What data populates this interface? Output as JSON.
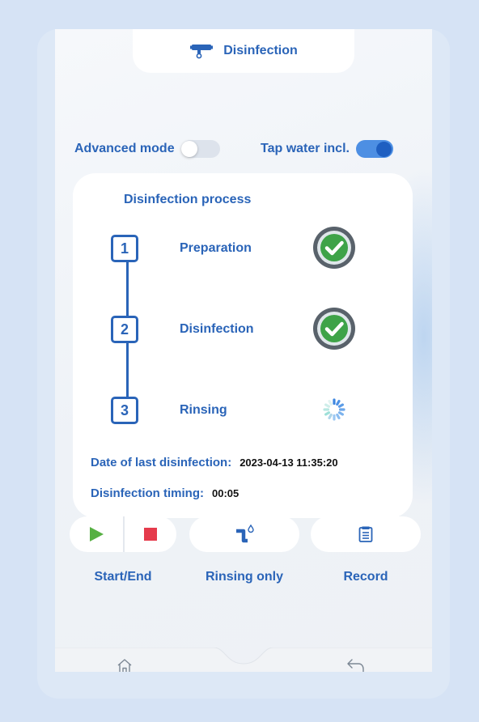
{
  "header": {
    "title": "Disinfection",
    "icon": "faucet-icon"
  },
  "toggles": {
    "advanced_mode": {
      "label": "Advanced mode",
      "state": "off"
    },
    "tap_water": {
      "label": "Tap water incl.",
      "state": "on"
    }
  },
  "process": {
    "title": "Disinfection process",
    "steps": [
      {
        "number": "1",
        "label": "Preparation",
        "status": "done"
      },
      {
        "number": "2",
        "label": "Disinfection",
        "status": "done"
      },
      {
        "number": "3",
        "label": "Rinsing",
        "status": "in-progress"
      }
    ],
    "last_date_label": "Date of last disinfection:",
    "last_date_value": "2023-04-13 11:35:20",
    "timing_label": "Disinfection timing:",
    "timing_value": "00:05"
  },
  "actions": [
    {
      "label": "Start/End",
      "icons": [
        "play-icon",
        "stop-icon"
      ]
    },
    {
      "label": "Rinsing only",
      "icons": [
        "pipe-drop-icon"
      ]
    },
    {
      "label": "Record",
      "icons": [
        "record-icon"
      ]
    }
  ],
  "bottom_nav": {
    "left": "home-icon",
    "right": "back-arrow-icon"
  },
  "colors": {
    "primary": "#2a64b8",
    "play": "#57b043",
    "stop": "#e53b4c",
    "check": "#3ea348",
    "background": "#d6e3f5"
  }
}
